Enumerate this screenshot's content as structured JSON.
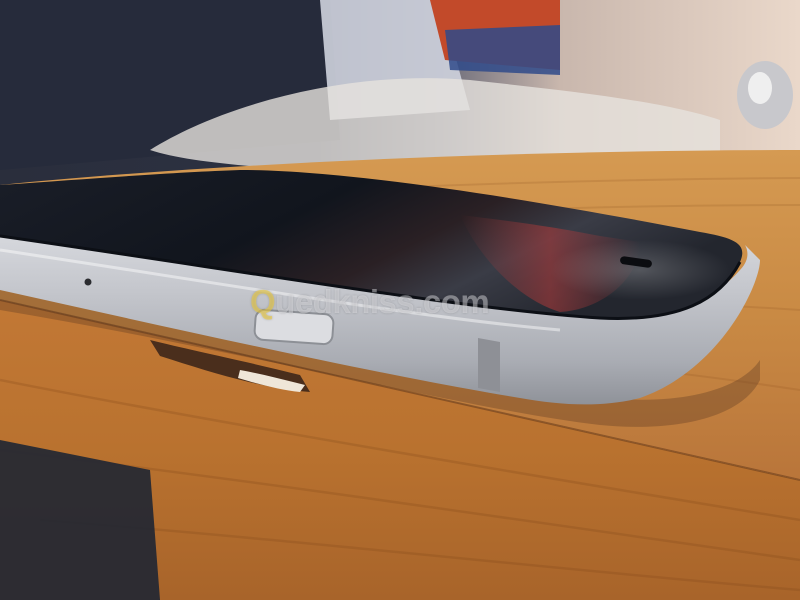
{
  "photo": {
    "subject": "phone-on-table",
    "colors": {
      "table_wood": "#c9803a",
      "table_edge": "#b4652a",
      "phone_frame": "#b9bcc2",
      "phone_screen": "#151a22",
      "background_wall": "#e8d6c7"
    }
  },
  "watermark": {
    "prefix": "Q",
    "rest": "uedkniss.com"
  }
}
